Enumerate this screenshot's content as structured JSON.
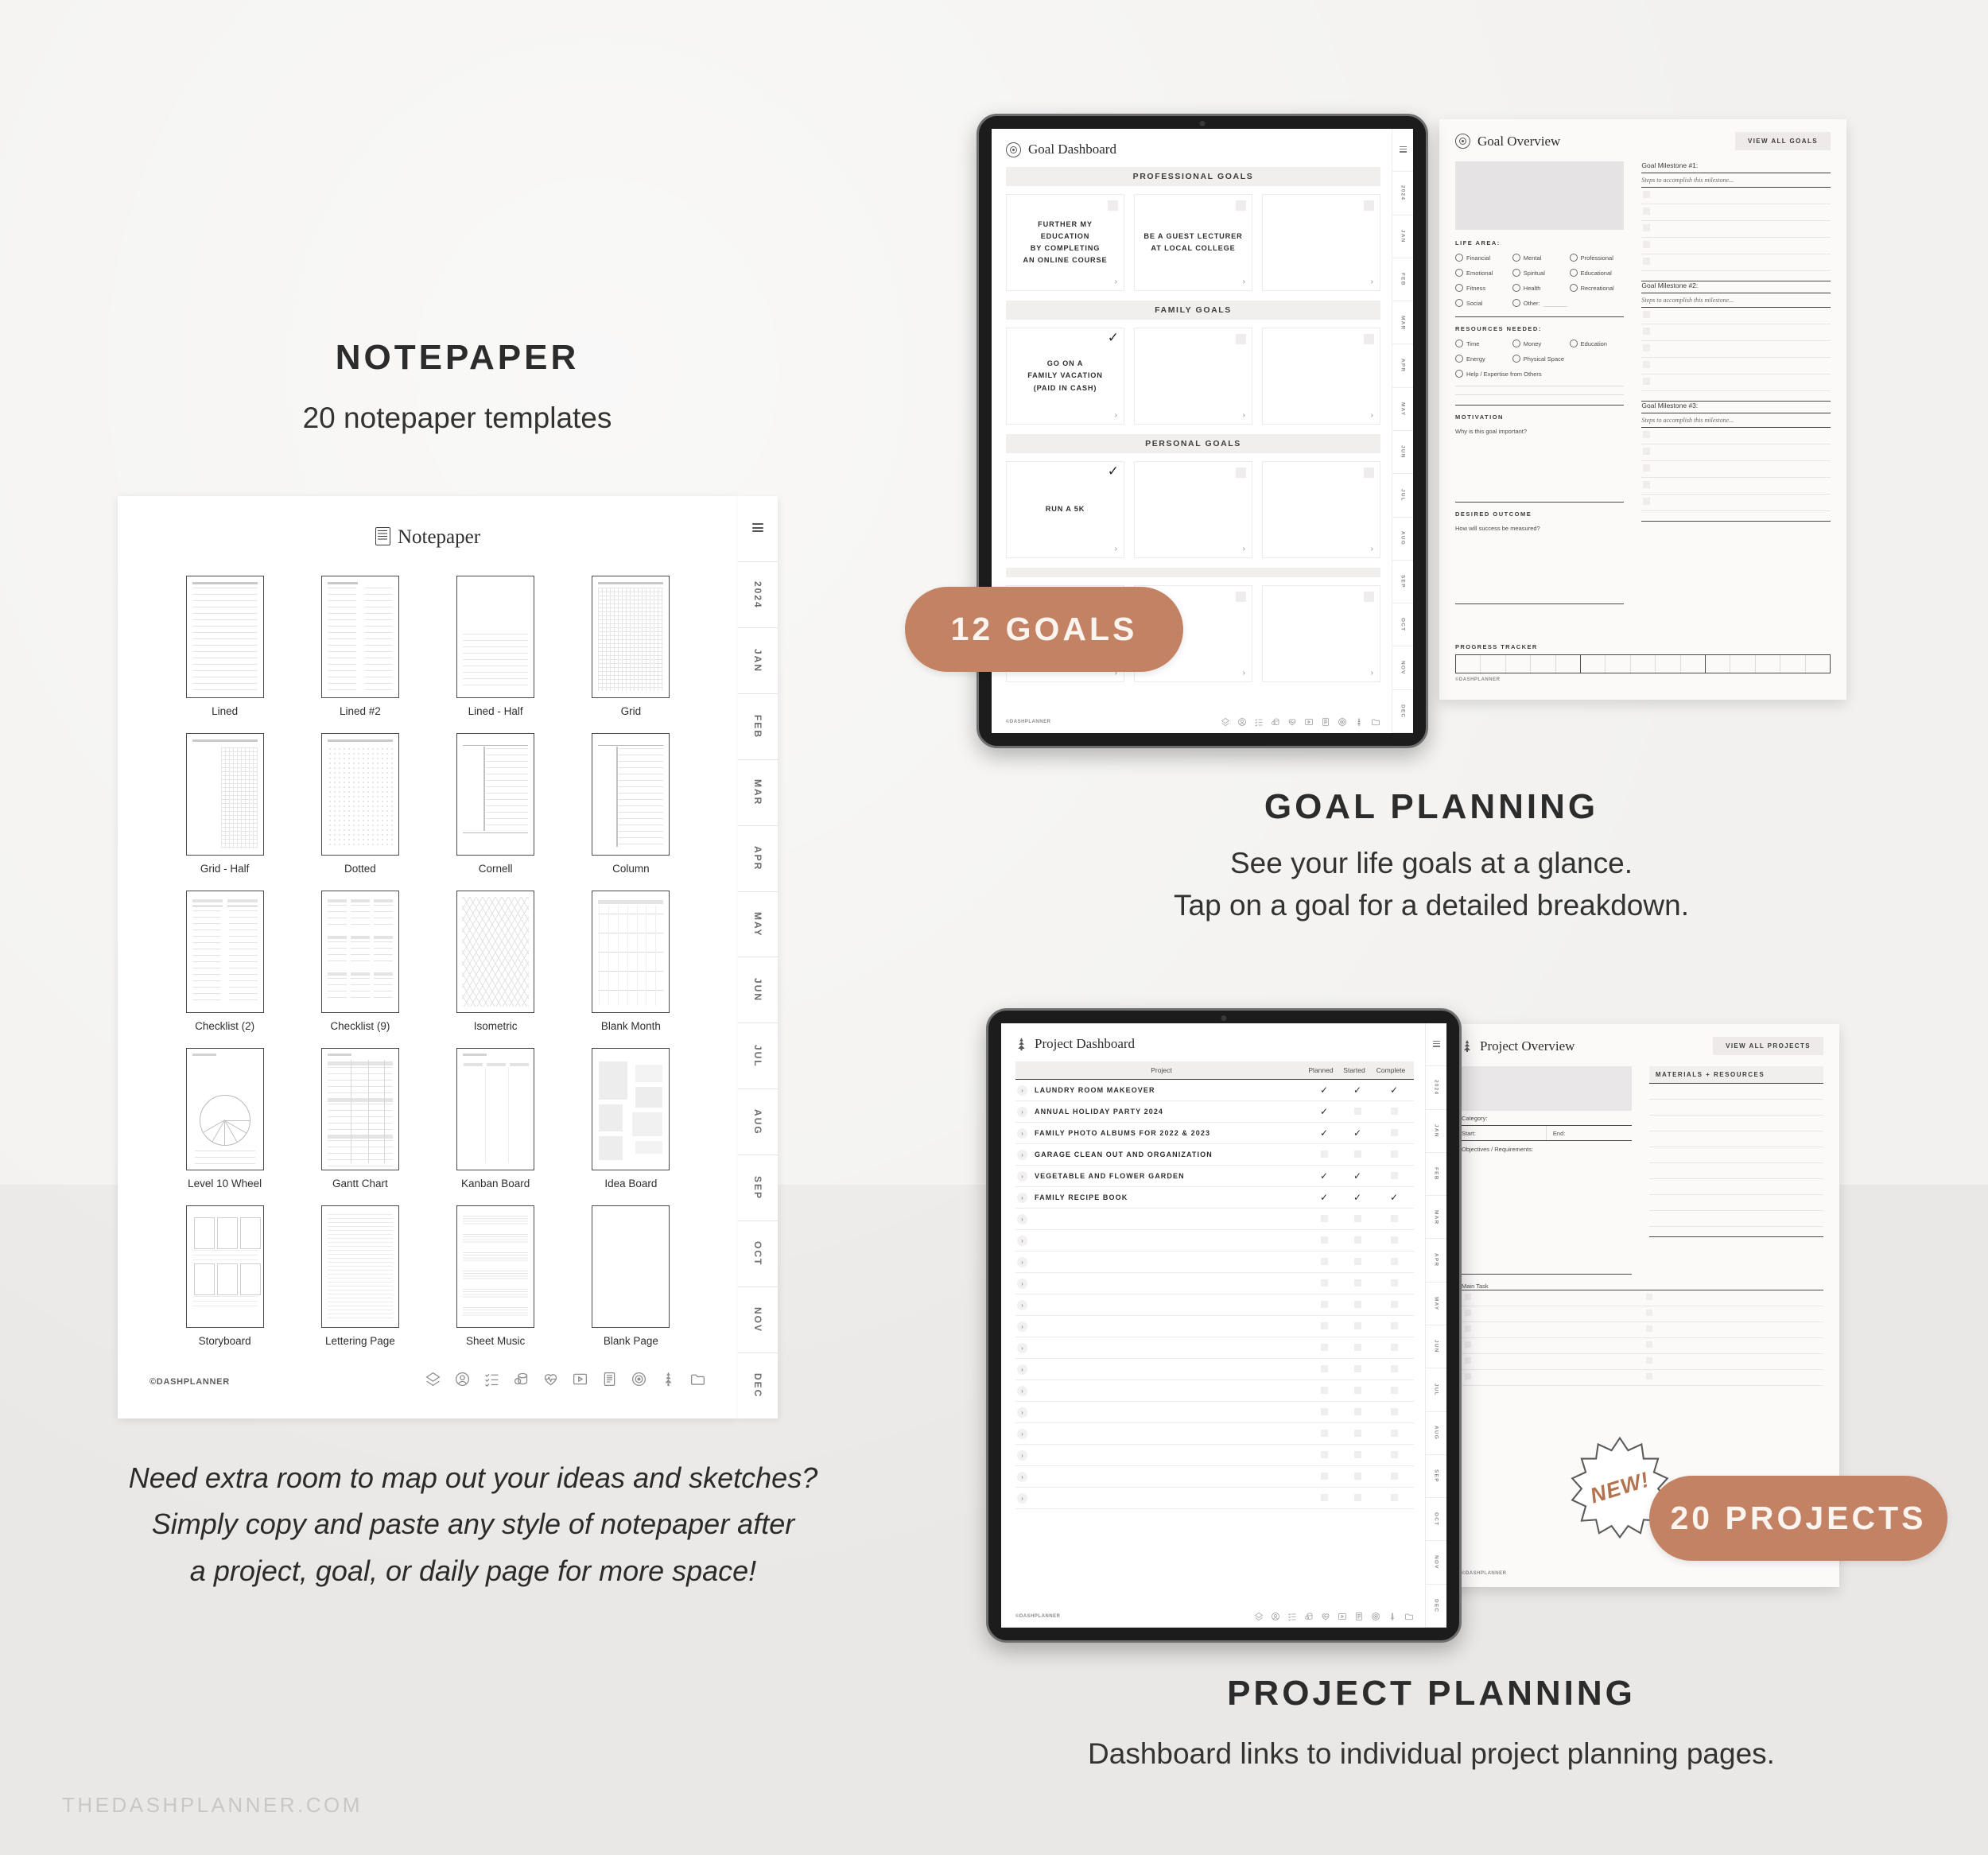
{
  "brand": {
    "watermark": "THEDASHPLANNER.COM",
    "page_credit": "©DASHPLANNER"
  },
  "colors": {
    "accent": "#C28263",
    "accent_text": "#FBF4EF",
    "paper": "#FFFFFF",
    "bg_top": "#F2F1EF",
    "bg_bottom": "#EAE8E6",
    "band": "#F1EFEE"
  },
  "sections": {
    "notepaper": {
      "heading": "NOTEPAPER",
      "subheading": "20 notepaper templates",
      "note": "Need extra room to map out your ideas and sketches?\nSimply copy and paste any style of notepaper after\na project, goal, or daily page for more space!",
      "note_lines": [
        "Need extra room to map out your ideas and sketches?",
        "Simply copy and paste any style of notepaper after",
        "a project, goal, or daily page for more space!"
      ]
    },
    "goal_planning": {
      "heading": "GOAL PLANNING",
      "sub_lines": [
        "See your life goals at a glance.",
        "Tap on a goal for a detailed breakdown."
      ],
      "badge": "12 GOALS"
    },
    "project_planning": {
      "heading": "PROJECT PLANNING",
      "sub_lines": [
        "Dashboard links to individual project planning pages."
      ],
      "badge": "20 PROJECTS",
      "starburst": "NEW!"
    }
  },
  "notepaper_page": {
    "title": "Notepaper",
    "title_icon": "notepaper-icon",
    "templates": [
      {
        "label": "Lined",
        "style": "lined"
      },
      {
        "label": "Lined #2",
        "style": "lined2"
      },
      {
        "label": "Lined - Half",
        "style": "lined-half"
      },
      {
        "label": "Grid",
        "style": "grid"
      },
      {
        "label": "Grid - Half",
        "style": "grid-half"
      },
      {
        "label": "Dotted",
        "style": "dotted"
      },
      {
        "label": "Cornell",
        "style": "cornell"
      },
      {
        "label": "Column",
        "style": "column"
      },
      {
        "label": "Checklist (2)",
        "style": "checklist2"
      },
      {
        "label": "Checklist (9)",
        "style": "checklist9"
      },
      {
        "label": "Isometric",
        "style": "isometric"
      },
      {
        "label": "Blank Month",
        "style": "blank-month"
      },
      {
        "label": "Level 10 Wheel",
        "style": "wheel"
      },
      {
        "label": "Gantt Chart",
        "style": "gantt"
      },
      {
        "label": "Kanban Board",
        "style": "kanban"
      },
      {
        "label": "Idea Board",
        "style": "idea"
      },
      {
        "label": "Storyboard",
        "style": "storyboard"
      },
      {
        "label": "Lettering Page",
        "style": "lettering"
      },
      {
        "label": "Sheet Music",
        "style": "sheetmusic"
      },
      {
        "label": "Blank Page",
        "style": "blank"
      }
    ],
    "tabs": [
      "2024",
      "JAN",
      "FEB",
      "MAR",
      "APR",
      "MAY",
      "JUN",
      "JUL",
      "AUG",
      "SEP",
      "OCT",
      "NOV",
      "DEC"
    ],
    "footer_icons": [
      "dash-logo-icon",
      "profile-icon",
      "checklist-icon",
      "finance-icon",
      "health-icon",
      "video-icon",
      "notepaper-icon",
      "goal-target-icon",
      "project-icon",
      "folder-icon"
    ]
  },
  "goal_dashboard": {
    "title": "Goal Dashboard",
    "title_icon": "goal-target-icon",
    "groups": [
      {
        "band": "PROFESSIONAL GOALS",
        "cards": [
          {
            "text": "FURTHER MY EDUCATION\nBY COMPLETING\nAN ONLINE COURSE",
            "lines": [
              "FURTHER MY EDUCATION",
              "BY COMPLETING",
              "AN ONLINE COURSE"
            ],
            "checked": false
          },
          {
            "text": "BE A GUEST LECTURER\nAT LOCAL COLLEGE",
            "lines": [
              "BE A GUEST LECTURER",
              "AT LOCAL COLLEGE"
            ],
            "checked": false
          },
          {
            "text": "",
            "lines": [],
            "checked": false
          }
        ]
      },
      {
        "band": "FAMILY GOALS",
        "cards": [
          {
            "text": "GO ON A\nFAMILY VACATION\n(PAID IN CASH)",
            "lines": [
              "GO ON A",
              "FAMILY VACATION",
              "(PAID IN CASH)"
            ],
            "checked": true
          },
          {
            "text": "",
            "lines": [],
            "checked": false
          },
          {
            "text": "",
            "lines": [],
            "checked": false
          }
        ]
      },
      {
        "band": "PERSONAL GOALS",
        "cards": [
          {
            "text": "RUN A 5K",
            "lines": [
              "RUN A 5K"
            ],
            "checked": true
          },
          {
            "text": "",
            "lines": [],
            "checked": false
          },
          {
            "text": "",
            "lines": [],
            "checked": false
          }
        ]
      },
      {
        "band": "",
        "cards": [
          {
            "text": "",
            "lines": [],
            "checked": false
          },
          {
            "text": "",
            "lines": [],
            "checked": false
          },
          {
            "text": "",
            "lines": [],
            "checked": false
          }
        ]
      }
    ],
    "tabs": [
      "2024",
      "JAN",
      "FEB",
      "MAR",
      "APR",
      "MAY",
      "JUN",
      "JUL",
      "AUG",
      "SEP",
      "OCT",
      "NOV",
      "DEC"
    ]
  },
  "goal_overview": {
    "title": "Goal Overview",
    "title_icon": "goal-target-icon",
    "view_all_button": "VIEW ALL GOALS",
    "life_area_label": "LIFE AREA:",
    "life_areas": [
      "Financial",
      "Mental",
      "Professional",
      "Emotional",
      "Spiritual",
      "Educational",
      "Fitness",
      "Health",
      "Recreational",
      "Social",
      "Other:"
    ],
    "resources_label": "RESOURCES NEEDED:",
    "resources": [
      "Time",
      "Money",
      "Education",
      "Energy",
      "Physical Space",
      "Help / Expertise from Others"
    ],
    "motivation_label": "MOTIVATION",
    "motivation_q": "Why is this goal important?",
    "outcome_label": "DESIRED OUTCOME",
    "outcome_q": "How will success be measured?",
    "progress_label": "PROGRESS TRACKER",
    "milestones": [
      {
        "title": "Goal Milestone #1:",
        "steps": "Steps to accomplish this milestone..."
      },
      {
        "title": "Goal Milestone #2:",
        "steps": "Steps to accomplish this milestone..."
      },
      {
        "title": "Goal Milestone #3:",
        "steps": "Steps to accomplish this milestone..."
      }
    ]
  },
  "project_dashboard": {
    "title": "Project Dashboard",
    "title_icon": "project-icon",
    "columns": [
      "Project",
      "Planned",
      "Started",
      "Complete"
    ],
    "rows": [
      {
        "name": "LAUNDRY ROOM MAKEOVER",
        "planned": true,
        "started": true,
        "complete": true
      },
      {
        "name": "ANNUAL HOLIDAY PARTY 2024",
        "planned": true,
        "started": false,
        "complete": false
      },
      {
        "name": "FAMILY PHOTO ALBUMS FOR 2022 & 2023",
        "planned": true,
        "started": true,
        "complete": false
      },
      {
        "name": "GARAGE CLEAN OUT AND ORGANIZATION",
        "planned": false,
        "started": false,
        "complete": false
      },
      {
        "name": "VEGETABLE AND FLOWER GARDEN",
        "planned": true,
        "started": true,
        "complete": false
      },
      {
        "name": "FAMILY RECIPE BOOK",
        "planned": true,
        "started": true,
        "complete": true
      },
      {
        "name": "",
        "planned": false,
        "started": false,
        "complete": false
      },
      {
        "name": "",
        "planned": false,
        "started": false,
        "complete": false
      },
      {
        "name": "",
        "planned": false,
        "started": false,
        "complete": false
      },
      {
        "name": "",
        "planned": false,
        "started": false,
        "complete": false
      },
      {
        "name": "",
        "planned": false,
        "started": false,
        "complete": false
      },
      {
        "name": "",
        "planned": false,
        "started": false,
        "complete": false
      },
      {
        "name": "",
        "planned": false,
        "started": false,
        "complete": false
      },
      {
        "name": "",
        "planned": false,
        "started": false,
        "complete": false
      },
      {
        "name": "",
        "planned": false,
        "started": false,
        "complete": false
      },
      {
        "name": "",
        "planned": false,
        "started": false,
        "complete": false
      },
      {
        "name": "",
        "planned": false,
        "started": false,
        "complete": false
      },
      {
        "name": "",
        "planned": false,
        "started": false,
        "complete": false
      },
      {
        "name": "",
        "planned": false,
        "started": false,
        "complete": false
      },
      {
        "name": "",
        "planned": false,
        "started": false,
        "complete": false
      }
    ],
    "tabs": [
      "2024",
      "JAN",
      "FEB",
      "MAR",
      "APR",
      "MAY",
      "JUN",
      "JUL",
      "AUG",
      "SEP",
      "OCT",
      "NOV",
      "DEC"
    ]
  },
  "project_overview": {
    "title": "Project Overview",
    "title_icon": "project-icon",
    "view_all_button": "VIEW ALL PROJECTS",
    "category_label": "Category:",
    "start_label": "Start:",
    "end_label": "End:",
    "objectives_label": "Objectives / Requirements:",
    "main_task_label": "Main Task",
    "materials_band": "MATERIALS + RESOURCES"
  }
}
